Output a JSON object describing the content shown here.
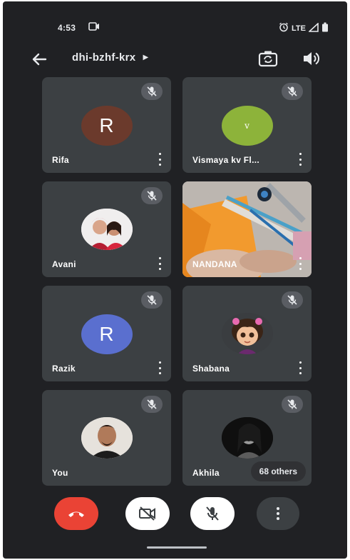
{
  "status_bar": {
    "time": "4:53",
    "network": "LTE"
  },
  "header": {
    "meeting_code": "dhi-bzhf-krx"
  },
  "participants": [
    {
      "name": "Rifa",
      "initial": "R",
      "avatar_color": "#6b3a2c"
    },
    {
      "name": "Vismaya kv Fl...",
      "initial": "v",
      "avatar_color": "#8db33a"
    },
    {
      "name": "Avani",
      "avatar_kind": "photo"
    },
    {
      "name": "NANDANA",
      "avatar_kind": "video"
    },
    {
      "name": "Razik",
      "initial": "R",
      "avatar_color": "#5a6fcf"
    },
    {
      "name": "Shabana",
      "avatar_kind": "photo"
    },
    {
      "name": "You",
      "avatar_kind": "photo"
    },
    {
      "name": "Akhila",
      "avatar_kind": "photo",
      "others_label": "68 others"
    }
  ],
  "controls": {
    "end_call_color": "#ea4335",
    "camera_state": "off",
    "mic_state": "muted"
  }
}
